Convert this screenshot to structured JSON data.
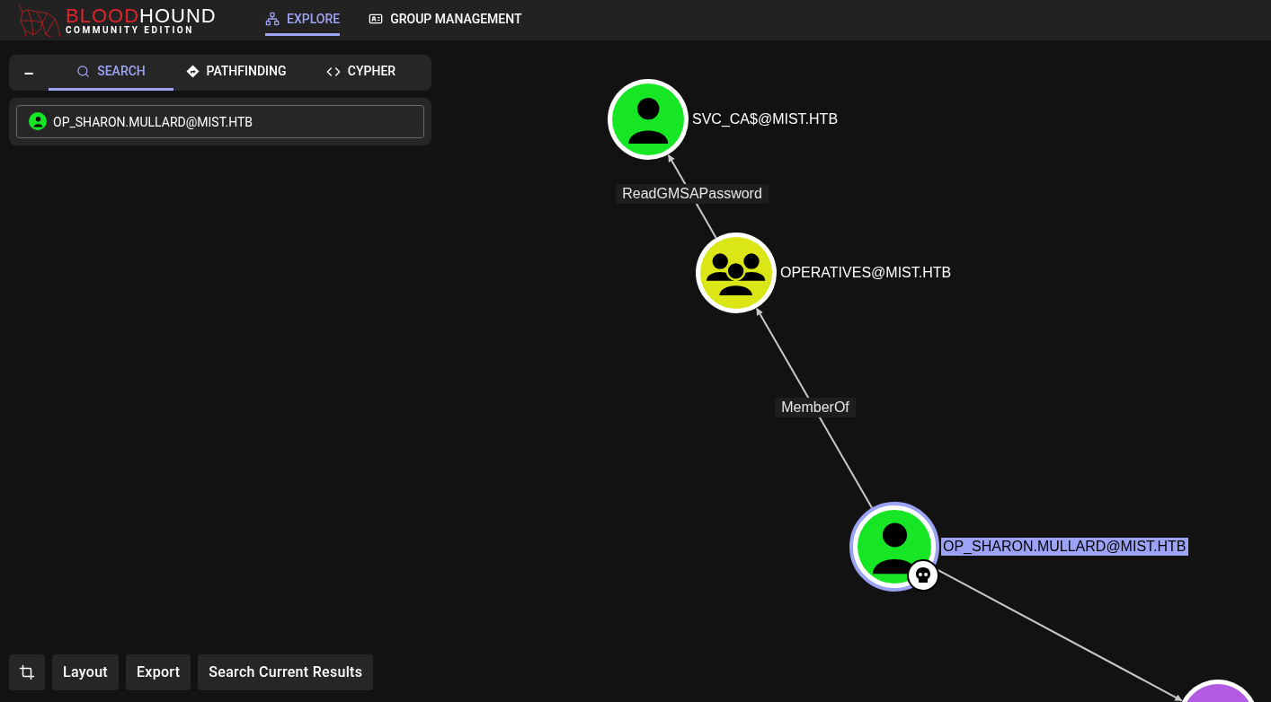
{
  "header": {
    "logo": {
      "title": [
        {
          "text": "BLOOD",
          "accent": true
        },
        {
          "text": "HOUND",
          "accent": false
        }
      ],
      "subtitle": "COMMUNITY EDITION"
    },
    "nav": [
      {
        "label": "EXPLORE",
        "selected": true
      },
      {
        "label": "GROUP MANAGEMENT",
        "selected": false
      }
    ]
  },
  "search_panel": {
    "collapse": "–",
    "tabs": [
      {
        "label": "SEARCH",
        "selected": true
      },
      {
        "label": "PATHFINDING",
        "selected": false
      },
      {
        "label": "CYPHER",
        "selected": false
      }
    ],
    "query": {
      "kind": "user",
      "value": "OP_SHARON.MULLARD@MIST.HTB"
    }
  },
  "graph": {
    "nodes": [
      {
        "kind": "user",
        "label": "SVC_CA$@MIST.HTB",
        "color": "#17e625",
        "selected": false,
        "owned": false
      },
      {
        "kind": "group",
        "label": "OPERATIVES@MIST.HTB",
        "color": "#dbe617",
        "selected": false,
        "owned": false
      },
      {
        "kind": "user",
        "label": "OP_SHARON.MULLARD@MIST.HTB",
        "color": "#17e625",
        "selected": true,
        "owned": true
      },
      {
        "kind": "other",
        "color": "#b35ae3",
        "selected": false
      }
    ],
    "edges": [
      {
        "label": "ReadGMSAPassword"
      },
      {
        "label": "MemberOf"
      }
    ]
  },
  "toolbar": {
    "buttons": [
      {
        "kind": "icon"
      },
      {
        "kind": "text",
        "label": "Layout"
      },
      {
        "kind": "text",
        "label": "Export"
      },
      {
        "kind": "text",
        "label": "Search Current Results"
      }
    ]
  }
}
